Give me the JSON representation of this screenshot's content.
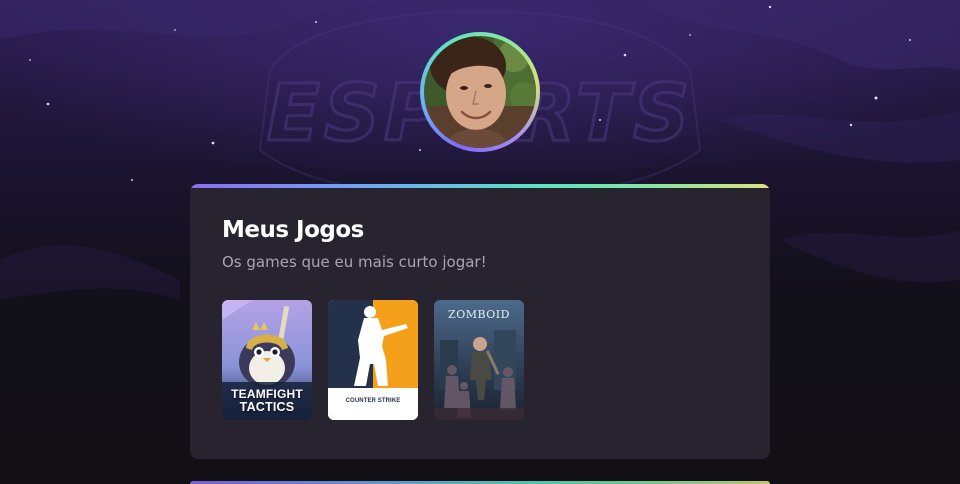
{
  "background": {
    "watermark_text": "ESPORTS"
  },
  "profile": {
    "avatar_icon": "user-photo"
  },
  "games_section": {
    "title": "Meus Jogos",
    "subtitle": "Os games que eu mais curto jogar!",
    "games": [
      {
        "title_line1": "TEAMFIGHT",
        "title_line2": "TACTICS",
        "icon": "teamfight-tactics-cover"
      },
      {
        "title": "COUNTER STRIKE",
        "icon": "counter-strike-cover"
      },
      {
        "title": "ZOMBOID",
        "icon": "project-zomboid-cover"
      }
    ]
  },
  "colors": {
    "accent_gradient": [
      "#8c6cf4",
      "#6ab0f0",
      "#5ee2c1",
      "#85e6a0",
      "#e0e27a"
    ],
    "card_background": "#27232f",
    "title_text": "#ffffff",
    "subtitle_text": "#a8a4b4"
  }
}
